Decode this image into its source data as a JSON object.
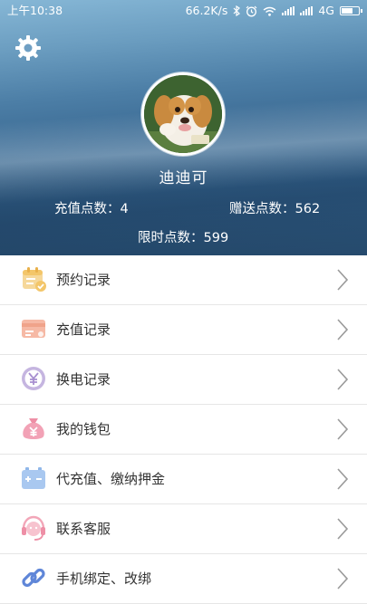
{
  "status_bar": {
    "time": "上午10:38",
    "network_speed": "66.2K/s",
    "network_type": "4G",
    "icons": [
      "bluetooth-icon",
      "alarm-icon",
      "wifi-icon",
      "signal-icon",
      "signal-icon",
      "battery-icon"
    ]
  },
  "header": {
    "settings_icon": "gear-icon",
    "avatar_icon": "puppy-avatar",
    "username": "迪迪可",
    "stats": {
      "recharge": "充值点数：4",
      "gift": "赠送点数：562",
      "limited": "限时点数：599"
    }
  },
  "menu": {
    "items": [
      {
        "label": "预约记录",
        "icon": "calendar-check-icon",
        "color": "#f3c66a"
      },
      {
        "label": "充值记录",
        "icon": "card-icon",
        "color": "#f0a38a"
      },
      {
        "label": "换电记录",
        "icon": "yen-coin-icon",
        "color": "#b7a3d6"
      },
      {
        "label": "我的钱包",
        "icon": "money-bag-icon",
        "color": "#ee8fa6"
      },
      {
        "label": "代充值、缴纳押金",
        "icon": "battery-deposit-icon",
        "color": "#8fb7ea"
      },
      {
        "label": "联系客服",
        "icon": "headset-icon",
        "color": "#f2a6b8"
      },
      {
        "label": "手机绑定、改绑",
        "icon": "link-icon",
        "color": "#5f86d8"
      }
    ]
  },
  "colors": {
    "header_top": "#86b7d6",
    "header_bottom": "#2a537a",
    "divider": "#e6e6e6",
    "text": "#333333",
    "arrow": "#9a9a9a"
  }
}
